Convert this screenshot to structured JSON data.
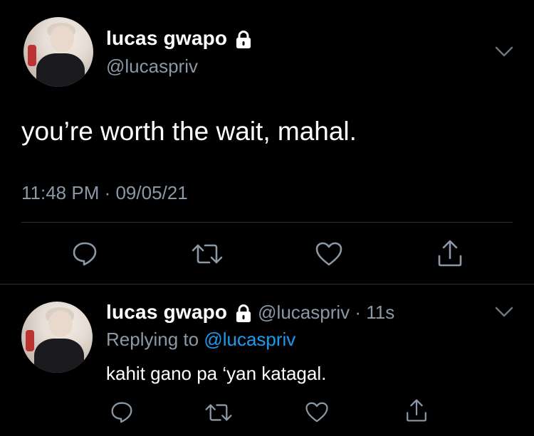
{
  "main_tweet": {
    "display_name": "lucas gwapo",
    "handle": "@lucaspriv",
    "text": "you’re worth the wait, mahal.",
    "timestamp": "11:48 PM · 09/05/21",
    "actions": [
      "reply-icon",
      "retweet-icon",
      "like-icon",
      "share-icon"
    ]
  },
  "reply_tweet": {
    "display_name": "lucas gwapo",
    "handle_time": "@lucaspriv · 11s",
    "replying_prefix": "Replying to",
    "replying_handle": "@lucaspriv",
    "text": "kahit gano pa ‘yan katagal.",
    "actions": [
      "reply-icon",
      "retweet-icon",
      "like-icon",
      "share-icon"
    ]
  },
  "colors": {
    "background": "#000000",
    "text": "#ffffff",
    "secondary": "#8b98a5",
    "link": "#1d9bf0",
    "divider": "#2f3336"
  }
}
